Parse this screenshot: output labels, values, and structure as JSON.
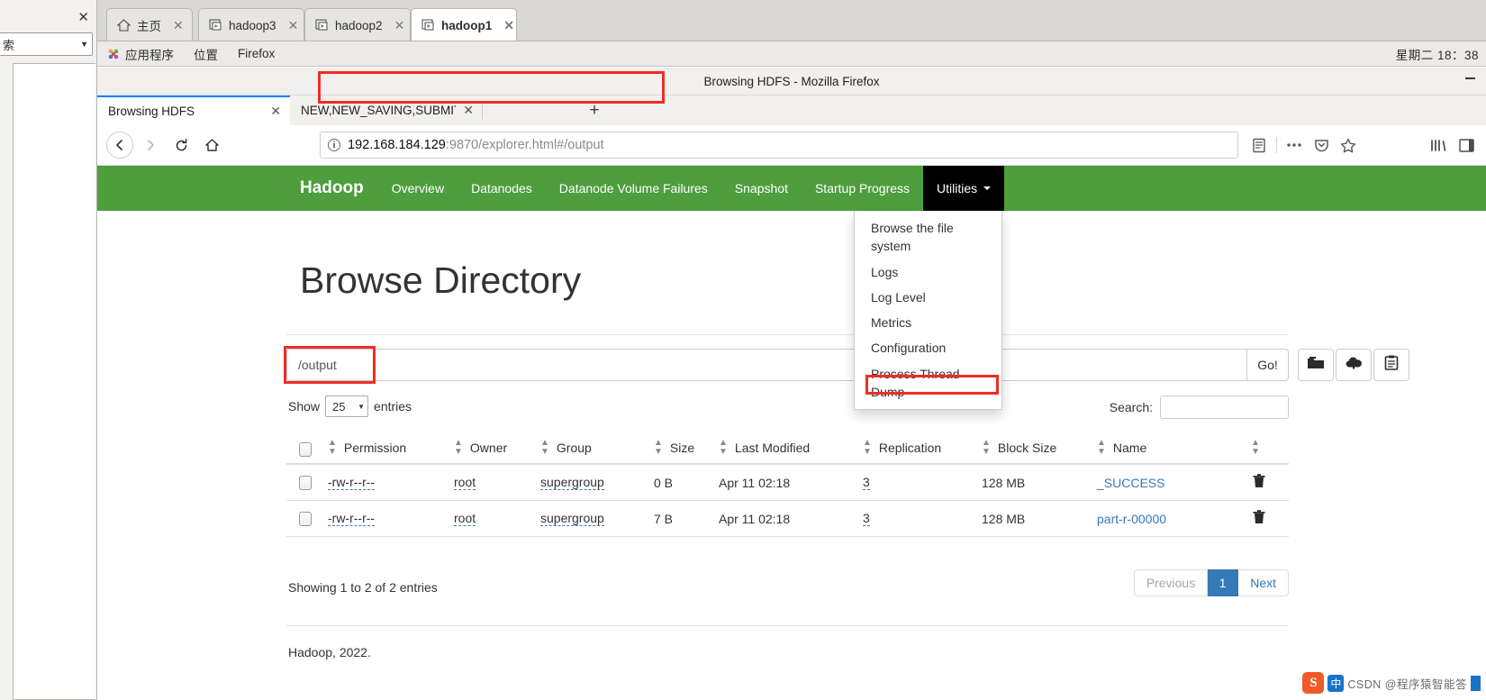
{
  "desktop": {
    "left_panel": {
      "close_label": "✕",
      "combo_value": "索"
    },
    "vm_tabs": [
      {
        "label": "主页",
        "icon": "home-icon",
        "active": false
      },
      {
        "label": "hadoop3",
        "icon": "vm-icon",
        "active": false
      },
      {
        "label": "hadoop2",
        "icon": "vm-icon",
        "active": false
      },
      {
        "label": "hadoop1",
        "icon": "vm-icon",
        "active": true
      }
    ],
    "gnome_menu": [
      {
        "label": "应用程序",
        "icon": "gnome-logo-icon"
      },
      {
        "label": "位置",
        "icon": ""
      },
      {
        "label": "Firefox",
        "icon": ""
      }
    ],
    "clock": "星期二 18：38"
  },
  "browser": {
    "window_title": "Browsing HDFS - Mozilla Firefox",
    "tabs": [
      {
        "label": "Browsing HDFS",
        "active": true,
        "close": "✕"
      },
      {
        "label": "NEW,NEW_SAVING,SUBMIT",
        "active": false,
        "close": "✕"
      }
    ],
    "new_tab_label": "+",
    "nav": {
      "back": "←",
      "forward": "→",
      "reload": "↻",
      "home": "⌂"
    },
    "url": {
      "host": "192.168.184.129",
      "rest": ":9870/explorer.html#/output",
      "info_glyph": "i"
    },
    "toolbar_icons": [
      "reader-view-icon",
      "page-actions-icon",
      "pocket-icon",
      "bookmark-star-icon",
      "library-icon",
      "sidebar-icon"
    ]
  },
  "hadoop": {
    "brand": "Hadoop",
    "navlinks": [
      {
        "label": "Overview"
      },
      {
        "label": "Datanodes"
      },
      {
        "label": "Datanode Volume Failures"
      },
      {
        "label": "Snapshot"
      },
      {
        "label": "Startup Progress"
      }
    ],
    "utilities": {
      "label": "Utilities",
      "items": [
        "Browse the file system",
        "Logs",
        "Log Level",
        "Metrics",
        "Configuration",
        "Process Thread Dump"
      ]
    },
    "page_title": "Browse Directory",
    "path_value": "/output",
    "go_label": "Go!",
    "action_icons": [
      "new-directory-icon",
      "upload-file-icon",
      "cut-paste-icon"
    ],
    "show_label": "Show",
    "entries_label": "entries",
    "page_size": "25",
    "search_label": "Search:",
    "search_value": "",
    "columns": [
      "Permission",
      "Owner",
      "Group",
      "Size",
      "Last Modified",
      "Replication",
      "Block Size",
      "Name"
    ],
    "rows": [
      {
        "permission": "-rw-r--r--",
        "owner": "root",
        "group": "supergroup",
        "size": "0 B",
        "last_modified": "Apr 11 02:18",
        "replication": "3",
        "block_size": "128 MB",
        "name": "_SUCCESS"
      },
      {
        "permission": "-rw-r--r--",
        "owner": "root",
        "group": "supergroup",
        "size": "7 B",
        "last_modified": "Apr 11 02:18",
        "replication": "3",
        "block_size": "128 MB",
        "name": "part-r-00000"
      }
    ],
    "showing_text": "Showing 1 to 2 of 2 entries",
    "pager": {
      "previous": "Previous",
      "page": "1",
      "next": "Next"
    },
    "footer": "Hadoop, 2022."
  },
  "watermark": {
    "logo": "S",
    "cn_label": "中",
    "text": "CSDN @程序猿智能答"
  },
  "colors": {
    "hadoop_green": "#4e9e3e",
    "highlight_red": "#ee2e24",
    "link_blue": "#337ab7",
    "active_page_blue": "#337ab7",
    "watermark_orange": "#f05a28"
  }
}
